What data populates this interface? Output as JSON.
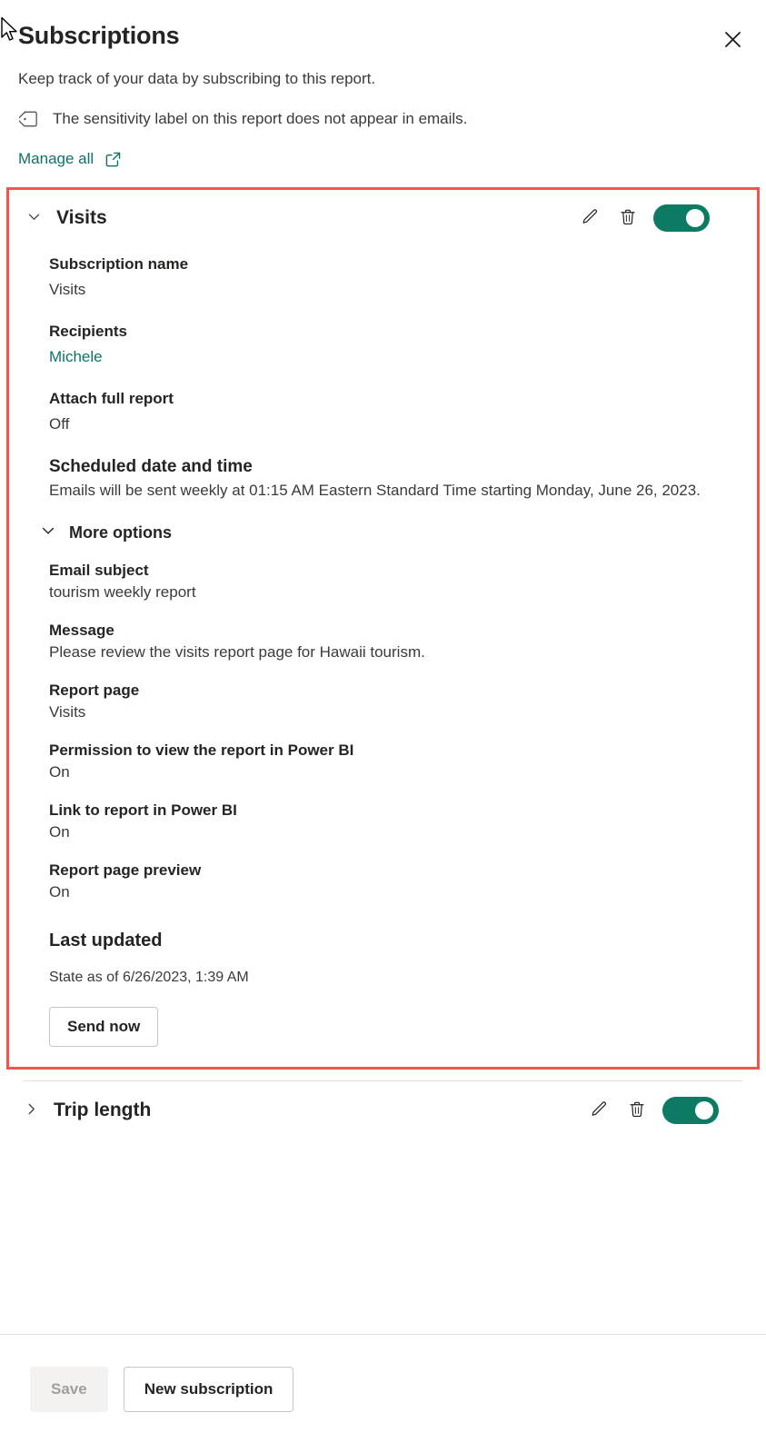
{
  "header": {
    "title": "Subscriptions",
    "close_icon": "close-icon",
    "subtitle": "Keep track of your data by subscribing to this report.",
    "sensitivity_icon": "tag-icon",
    "sensitivity_text": "The sensitivity label on this report does not appear in emails.",
    "manage_all_label": "Manage all",
    "manage_all_icon": "external-link-icon"
  },
  "subscriptions": [
    {
      "name": "Visits",
      "expanded": true,
      "chevron_icon": "chevron-down-icon",
      "edit_icon": "pencil-icon",
      "delete_icon": "trash-icon",
      "toggle_state": "On",
      "fields": {
        "subscription_name_label": "Subscription name",
        "subscription_name_value": "Visits",
        "recipients_label": "Recipients",
        "recipients_value": "Michele",
        "attach_full_report_label": "Attach full report",
        "attach_full_report_value": "Off",
        "scheduled_label": "Scheduled date and time",
        "scheduled_value": "Emails will be sent weekly at 01:15 AM Eastern Standard Time starting Monday, June 26, 2023.",
        "more_options_label": "More options",
        "more_options_icon": "chevron-down-icon",
        "email_subject_label": "Email subject",
        "email_subject_value": "tourism weekly report",
        "message_label": "Message",
        "message_value": "Please review the visits report page for Hawaii tourism.",
        "report_page_label": "Report page",
        "report_page_value": "Visits",
        "permission_label": "Permission to view the report in Power BI",
        "permission_value": "On",
        "link_label": "Link to report in Power BI",
        "link_value": "On",
        "preview_label": "Report page preview",
        "preview_value": "On",
        "last_updated_label": "Last updated",
        "last_updated_value": "State as of 6/26/2023, 1:39 AM",
        "send_now_label": "Send now"
      }
    },
    {
      "name": "Trip length",
      "expanded": false,
      "chevron_icon": "chevron-right-icon",
      "edit_icon": "pencil-icon",
      "delete_icon": "trash-icon",
      "toggle_state": "On"
    }
  ],
  "footer": {
    "save_label": "Save",
    "save_disabled": true,
    "new_subscription_label": "New subscription"
  },
  "colors": {
    "accent_teal": "#0f7268",
    "toggle_on": "#0d7a63",
    "highlight_red": "#f7534d",
    "text_primary": "#252423",
    "text_secondary": "#3b3a39",
    "disabled_text": "#a19f9d",
    "disabled_bg": "#f3f2f1",
    "divider": "#e1dfdd"
  }
}
